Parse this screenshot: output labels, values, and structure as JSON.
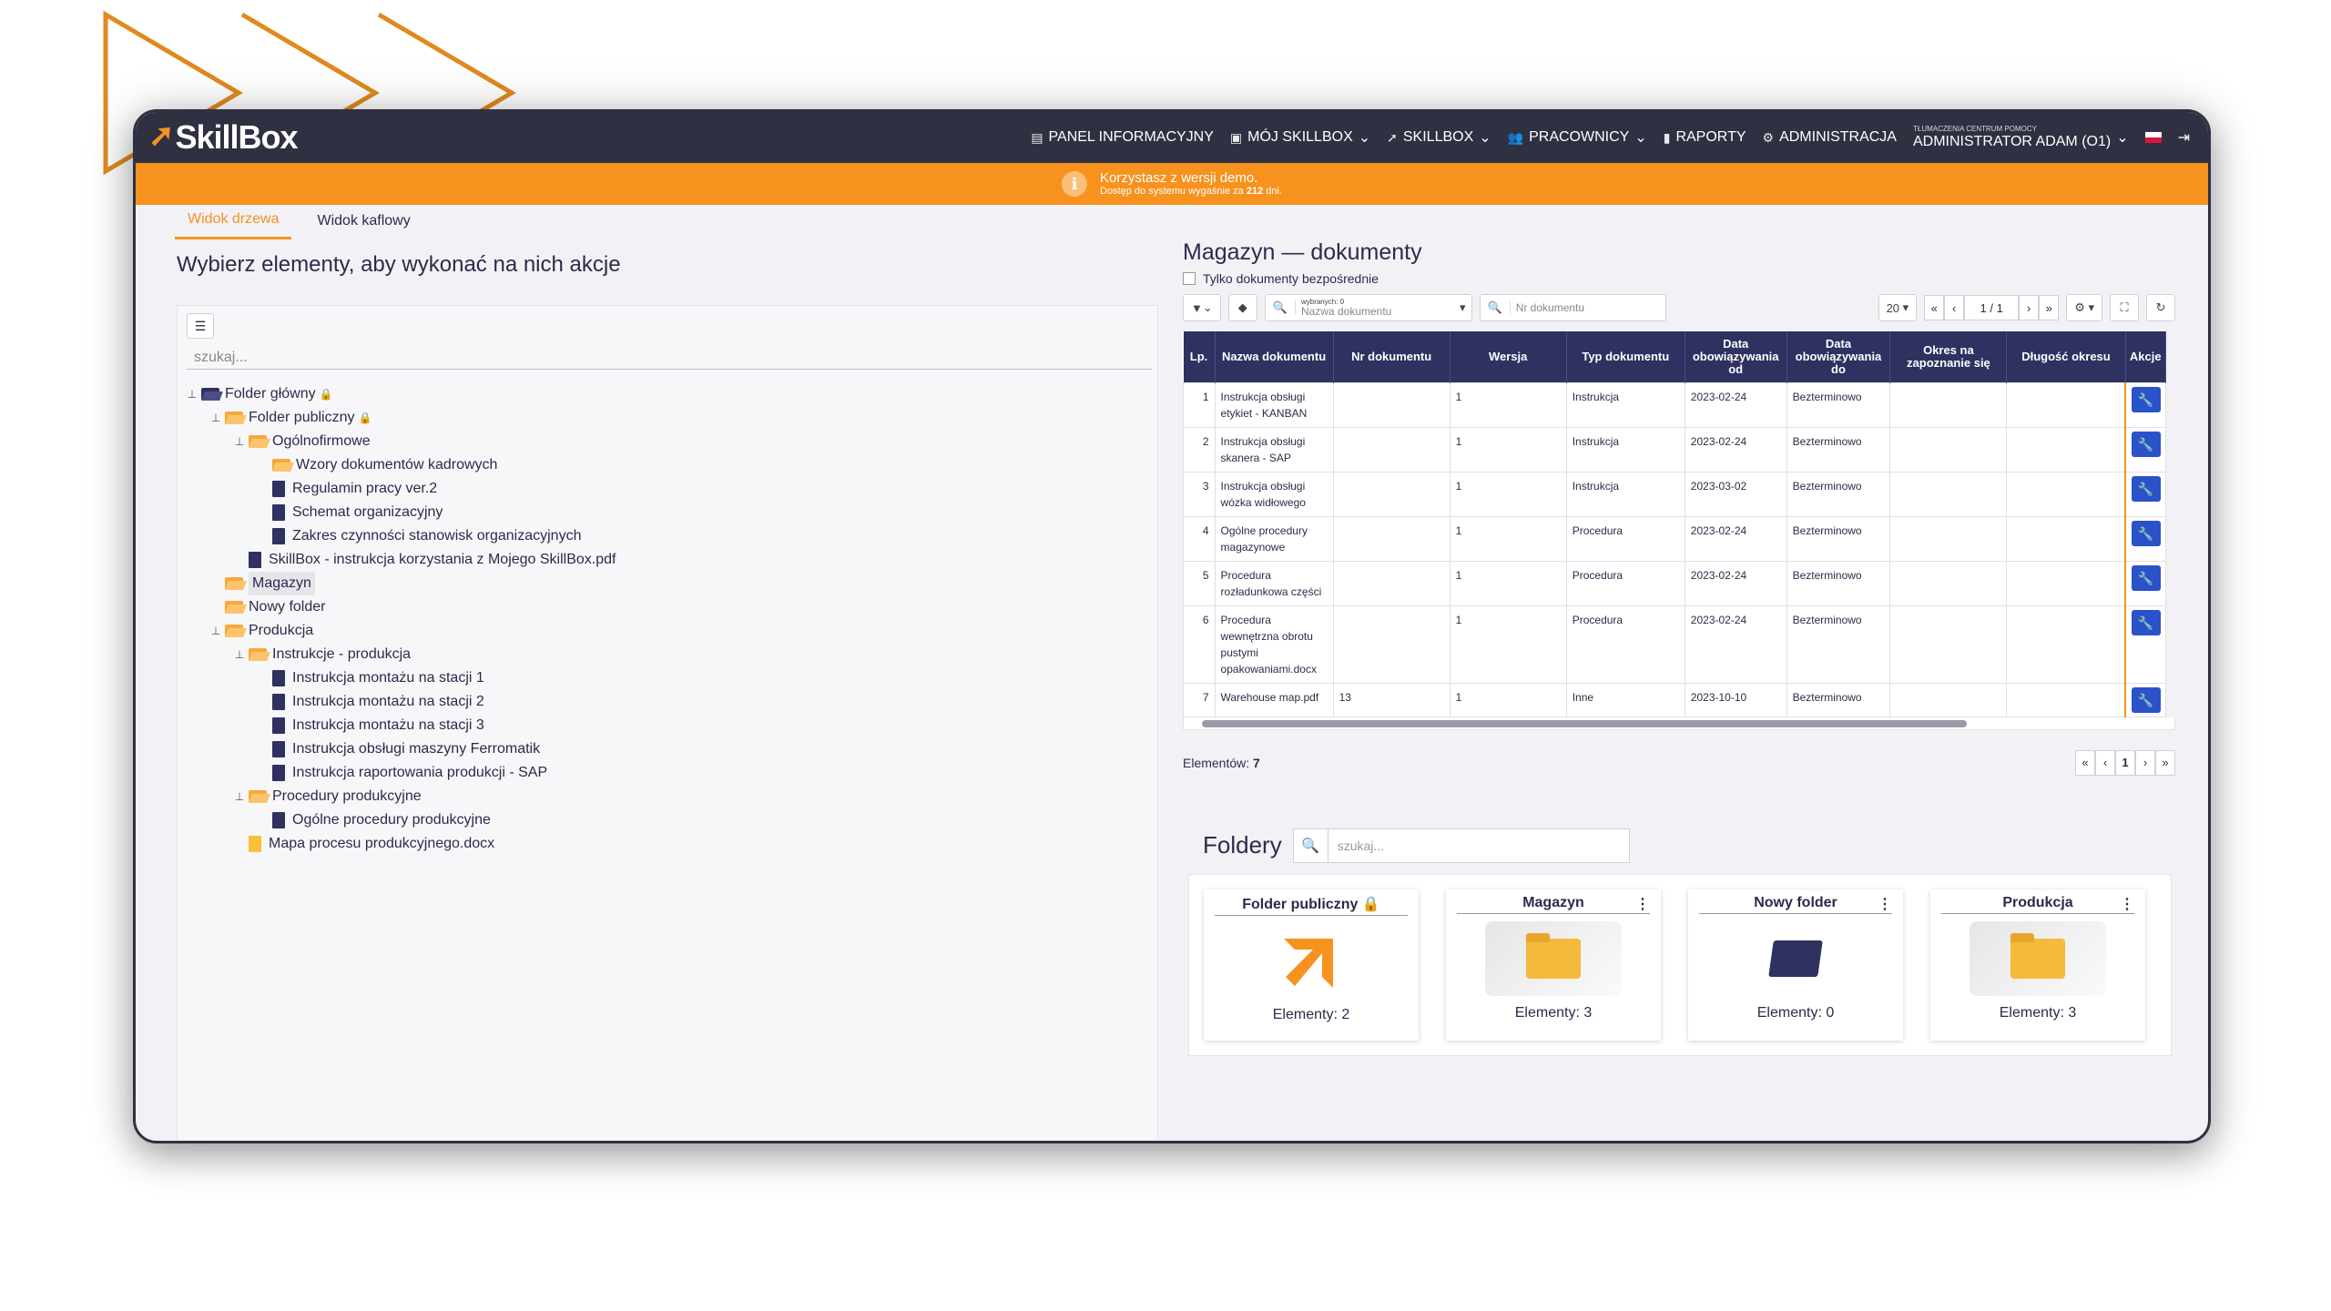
{
  "brand": {
    "name": "SkillBox",
    "accent": "#f7921e",
    "dark": "#2f3142",
    "navy": "#2f3161"
  },
  "nav": {
    "items": [
      {
        "icon": "dashboard-icon",
        "label": "PANEL INFORMACYJNY"
      },
      {
        "icon": "id-card-icon",
        "label": "MÓJ SKILLBOX"
      },
      {
        "icon": "skillbox-arrow-icon",
        "label": "SKILLBOX"
      },
      {
        "icon": "users-icon",
        "label": "PRACOWNICY"
      },
      {
        "icon": "report-icon",
        "label": "RAPORTY"
      },
      {
        "icon": "cogs-icon",
        "label": "ADMINISTRACJA"
      }
    ],
    "help_link": "Tłumaczenia centrum pomocy",
    "user": "ADMINISTRATOR ADAM (O1)"
  },
  "banner": {
    "line1": "Korzystasz z wersji demo.",
    "line2_prefix": "Dostęp do systemu wygaśnie za ",
    "days": "212",
    "line2_suffix": " dni."
  },
  "left": {
    "tabs": [
      "Widok drzewa",
      "Widok kaflowy"
    ],
    "heading": "Wybierz elementy, aby wykonać na nich akcje",
    "search_placeholder": "szukaj...",
    "tree": {
      "root": "Folder główny",
      "public": "Folder publiczny",
      "general": "Ogólnofirmowe",
      "hr_templates": "Wzory dokumentów kadrowych",
      "reg": "Regulamin pracy ver.2",
      "org": "Schemat organizacyjny",
      "scope": "Zakres czynności stanowisk organizacyjnych",
      "guide": "SkillBox - instrukcja korzystania z Mojego SkillBox.pdf",
      "warehouse": "Magazyn",
      "newfolder": "Nowy folder",
      "production": "Produkcja",
      "instr_prod": "Instrukcje - produkcja",
      "i1": "Instrukcja montażu na stacji 1",
      "i2": "Instrukcja montażu na stacji 2",
      "i3": "Instrukcja montażu na stacji 3",
      "i4": "Instrukcja obsługi maszyny Ferromatik",
      "i5": "Instrukcja raportowania produkcji - SAP",
      "proc_prod": "Procedury produkcyjne",
      "p1": "Ogólne procedury produkcyjne",
      "map": "Mapa procesu produkcyjnego.docx"
    }
  },
  "right": {
    "heading": "Magazyn — dokumenty",
    "only_direct": "Tylko dokumenty bezpośrednie",
    "selected_label": "wybranych: 0",
    "name_filter": "Nazwa dokumentu",
    "nr_placeholder": "Nr dokumentu",
    "page_size": "20",
    "pager": {
      "page": "1",
      "total": "/ 1"
    },
    "columns": [
      "Lp.",
      "Nazwa dokumentu",
      "Nr dokumentu",
      "Wersja",
      "Typ dokumentu",
      "Data obowiązywania od",
      "Data obowiązywania do",
      "Okres na zapoznanie się",
      "Długość okresu",
      "Akcje"
    ],
    "rows": [
      [
        "1",
        "Instrukcja obsługi etykiet - KANBAN",
        "",
        "1",
        "Instrukcja",
        "2023-02-24",
        "Bezterminowo",
        "",
        ""
      ],
      [
        "2",
        "Instrukcja obsługi skanera - SAP",
        "",
        "1",
        "Instrukcja",
        "2023-02-24",
        "Bezterminowo",
        "",
        ""
      ],
      [
        "3",
        "Instrukcja obsługi wózka widłowego",
        "",
        "1",
        "Instrukcja",
        "2023-03-02",
        "Bezterminowo",
        "",
        ""
      ],
      [
        "4",
        "Ogólne procedury magazynowe",
        "",
        "1",
        "Procedura",
        "2023-02-24",
        "Bezterminowo",
        "",
        ""
      ],
      [
        "5",
        "Procedura rozładunkowa części",
        "",
        "1",
        "Procedura",
        "2023-02-24",
        "Bezterminowo",
        "",
        ""
      ],
      [
        "6",
        "Procedura wewnętrzna obrotu pustymi opakowaniami.docx",
        "",
        "1",
        "Procedura",
        "2023-02-24",
        "Bezterminowo",
        "",
        ""
      ],
      [
        "7",
        "Warehouse map.pdf",
        "13",
        "1",
        "Inne",
        "2023-10-10",
        "Bezterminowo",
        "",
        ""
      ]
    ],
    "elements_label": "Elementów:",
    "elements_count": "7",
    "bottom_page": "1",
    "folders_title": "Foldery",
    "folders_search": "szukaj...",
    "folders": [
      {
        "name": "Folder publiczny",
        "count": "Elementy: 2"
      },
      {
        "name": "Magazyn",
        "count": "Elementy: 3"
      },
      {
        "name": "Nowy folder",
        "count": "Elementy: 0"
      },
      {
        "name": "Produkcja",
        "count": "Elementy: 3"
      }
    ]
  }
}
